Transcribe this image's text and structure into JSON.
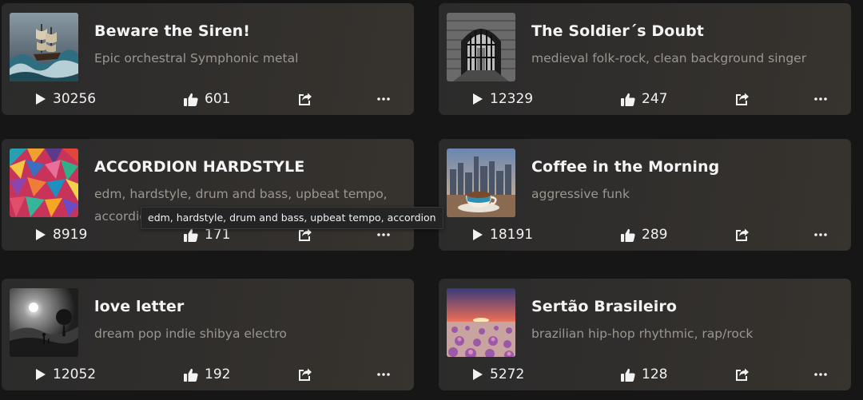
{
  "colors": {
    "page_background": "#161616",
    "card_background": "#302e2c",
    "title_text": "#f4f4f4",
    "tag_text": "#9b9790",
    "stat_text": "#f2f2f2"
  },
  "icons": {
    "play": "play-icon",
    "like": "thumbs-up-icon",
    "share": "share-icon",
    "more": "more-horizontal-icon"
  },
  "songs": [
    {
      "title": "Beware the Siren!",
      "tags": "Epic orchestral Symphonic metal",
      "plays": "30256",
      "likes": "601",
      "cover": "ship on stormy sea"
    },
    {
      "title": "The Soldier´s Doubt",
      "tags": "medieval folk-rock, clean background singer",
      "plays": "12329",
      "likes": "247",
      "cover": "barred stone window"
    },
    {
      "title": "ACCORDION HARDSTYLE",
      "tags": "edm, hardstyle, drum and bass, upbeat tempo, accordion",
      "plays": "8919",
      "likes": "171",
      "cover": "colorful geometric pattern"
    },
    {
      "title": "Coffee in the Morning",
      "tags": "aggressive funk",
      "plays": "18191",
      "likes": "289",
      "cover": "coffee cup with city skyline"
    },
    {
      "title": "love letter",
      "tags": "dream pop indie shibya electro",
      "plays": "12052",
      "likes": "192",
      "cover": "black and white moonlit landscape"
    },
    {
      "title": "Sertão Brasileiro",
      "tags": "brazilian hip-hop rhythmic, rap/rock",
      "plays": "5272",
      "likes": "128",
      "cover": "desert flowers at sunset"
    }
  ],
  "tooltip": {
    "text": "edm, hardstyle, drum and bass, upbeat tempo, accordion"
  }
}
